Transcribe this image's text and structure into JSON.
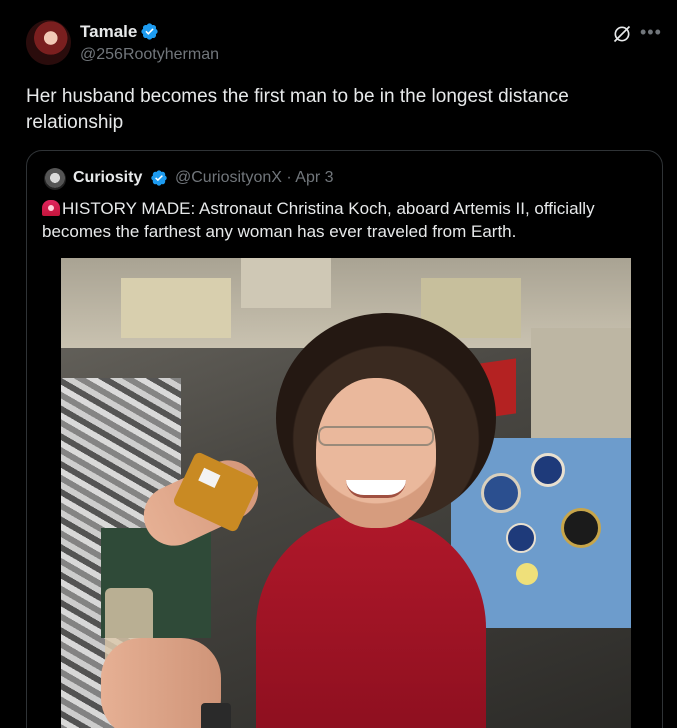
{
  "author": {
    "name": "Tamale",
    "handle": "@256Rootyherman"
  },
  "tweet": {
    "text": "Her husband becomes the first man to be in the longest distance relationship"
  },
  "quote": {
    "name": "Curiosity",
    "handle": "@CuriosityonX",
    "separator": "·",
    "date": "Apr 3",
    "text": "HISTORY MADE: Astronaut Christina Koch, aboard Artemis II, officially becomes the farthest any woman has ever traveled from Earth."
  },
  "icons": {
    "verified": "verified-badge-icon",
    "grok": "grok-icon",
    "more": "more-icon",
    "siren": "siren-emoji"
  },
  "colors": {
    "background": "#000000",
    "text": "#e7e9ea",
    "muted": "#71767b",
    "verified": "#1d9bf0",
    "border": "#2f3336"
  }
}
